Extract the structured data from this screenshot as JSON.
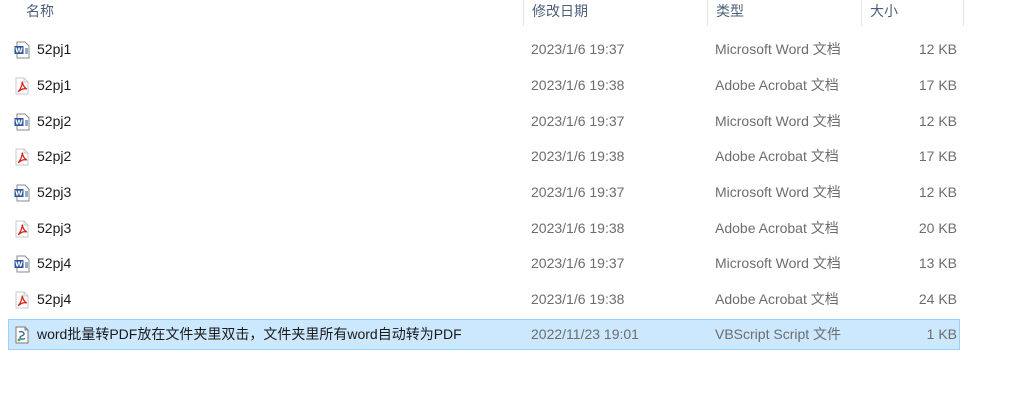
{
  "columns": {
    "name": "名称",
    "date": "修改日期",
    "type": "类型",
    "size": "大小"
  },
  "files": [
    {
      "name": "52pj1",
      "date": "2023/1/6 19:37",
      "type": "Microsoft Word 文档",
      "size": "12 KB",
      "icon": "word-doc-icon"
    },
    {
      "name": "52pj1",
      "date": "2023/1/6 19:38",
      "type": "Adobe Acrobat 文档",
      "size": "17 KB",
      "icon": "pdf-icon"
    },
    {
      "name": "52pj2",
      "date": "2023/1/6 19:37",
      "type": "Microsoft Word 文档",
      "size": "12 KB",
      "icon": "word-doc-icon"
    },
    {
      "name": "52pj2",
      "date": "2023/1/6 19:38",
      "type": "Adobe Acrobat 文档",
      "size": "17 KB",
      "icon": "pdf-icon"
    },
    {
      "name": "52pj3",
      "date": "2023/1/6 19:37",
      "type": "Microsoft Word 文档",
      "size": "12 KB",
      "icon": "word-doc-icon"
    },
    {
      "name": "52pj3",
      "date": "2023/1/6 19:38",
      "type": "Adobe Acrobat 文档",
      "size": "20 KB",
      "icon": "pdf-icon"
    },
    {
      "name": "52pj4",
      "date": "2023/1/6 19:37",
      "type": "Microsoft Word 文档",
      "size": "13 KB",
      "icon": "word-doc-icon"
    },
    {
      "name": "52pj4",
      "date": "2023/1/6 19:38",
      "type": "Adobe Acrobat 文档",
      "size": "24 KB",
      "icon": "pdf-icon"
    },
    {
      "name": "word批量转PDF放在文件夹里双击，文件夹里所有word自动转为PDF",
      "date": "2022/11/23 19:01",
      "type": "VBScript Script 文件",
      "size": "1 KB",
      "icon": "vbscript-icon",
      "selected": true
    }
  ],
  "colors": {
    "selection_bg": "#cce8ff",
    "selection_border": "#99d1ff",
    "header_text": "#4c607a",
    "word_blue": "#2b5797",
    "pdf_red": "#d7251d"
  }
}
